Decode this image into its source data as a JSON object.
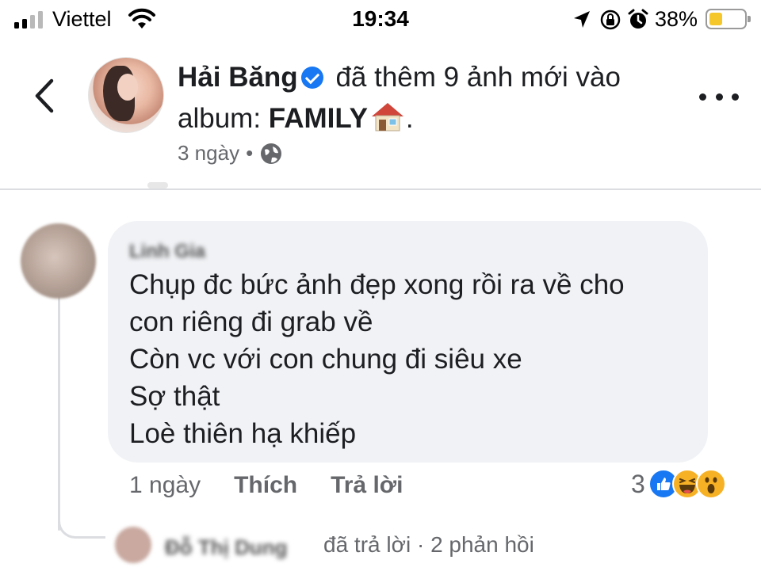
{
  "status_bar": {
    "carrier": "Viettel",
    "time": "19:34",
    "battery_percent_label": "38%",
    "battery_level": 0.38,
    "icons": [
      "signal-icon",
      "wifi-icon",
      "location-arrow-icon",
      "orientation-lock-icon",
      "alarm-icon",
      "battery-icon"
    ]
  },
  "post": {
    "author": "Hải Băng",
    "verified": true,
    "action_text": "đã thêm 9 ảnh mới vào album:",
    "album_name": "FAMILY",
    "album_emoji": "house-emoji",
    "album_suffix": ".",
    "time": "3 ngày",
    "separator": "•",
    "audience_icon": "globe-icon",
    "more_icon": "more-options-icon",
    "back_icon": "chevron-left-icon"
  },
  "comment": {
    "author": "Linh Gia",
    "author_blurred": true,
    "lines": [
      "Chụp đc bức ảnh đẹp xong rồi ra về cho",
      "con riêng đi grab về",
      "Còn vc với con chung đi siêu xe",
      "Sợ thật",
      "Loè thiên hạ khiếp"
    ],
    "time": "1 ngày",
    "like_label": "Thích",
    "reply_label": "Trả lời",
    "reaction_count": "3",
    "reactions": [
      "like-reaction-icon",
      "haha-reaction-icon",
      "wow-reaction-icon"
    ]
  },
  "replies": {
    "replier": "Đỗ Thị Dung",
    "replier_blurred": true,
    "summary": "đã trả lời · 2 phản hồi"
  },
  "colors": {
    "bubble_bg": "#f0f2f5",
    "meta_text": "#65676b",
    "like_blue": "#1877f2",
    "battery_yellow": "#f5c72a"
  }
}
